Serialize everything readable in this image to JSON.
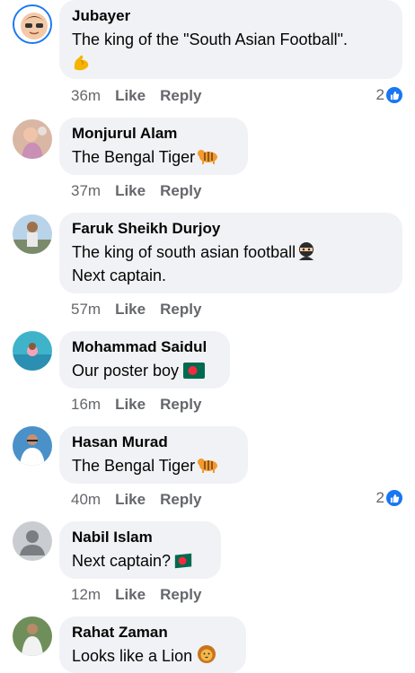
{
  "comments": [
    {
      "name": "Jubayer",
      "lines": [
        "The king of the \"South Asian Football\"."
      ],
      "time": "36m",
      "like": "Like",
      "reply": "Reply",
      "reactions": "2",
      "emoji": "flexed-biceps-emoji"
    },
    {
      "name": "Monjurul Alam",
      "lines": [
        "The Bengal Tiger"
      ],
      "time": "37m",
      "like": "Like",
      "reply": "Reply",
      "emoji": "tiger-emoji"
    },
    {
      "name": "Faruk Sheikh Durjoy",
      "lines": [
        "The king of south asian football",
        "Next captain."
      ],
      "time": "57m",
      "like": "Like",
      "reply": "Reply",
      "emoji": "ninja-emoji"
    },
    {
      "name": "Mohammad Saidul",
      "lines": [
        "Our poster boy"
      ],
      "time": "16m",
      "like": "Like",
      "reply": "Reply",
      "emoji": "bangladesh-flag-emoji"
    },
    {
      "name": "Hasan Murad",
      "lines": [
        "The Bengal Tiger"
      ],
      "time": "40m",
      "like": "Like",
      "reply": "Reply",
      "reactions": "2",
      "emoji": "tiger-emoji"
    },
    {
      "name": "Nabil Islam",
      "lines": [
        "Next captain?"
      ],
      "time": "12m",
      "like": "Like",
      "reply": "Reply",
      "emoji": "bangladesh-flag-emoji"
    },
    {
      "name": "Rahat Zaman",
      "lines": [
        "Looks like a Lion"
      ],
      "emoji": "lion-emoji"
    }
  ],
  "colors": {
    "bubble": "#f0f2f5",
    "meta": "#65676b",
    "like_badge": "#1877f2"
  }
}
